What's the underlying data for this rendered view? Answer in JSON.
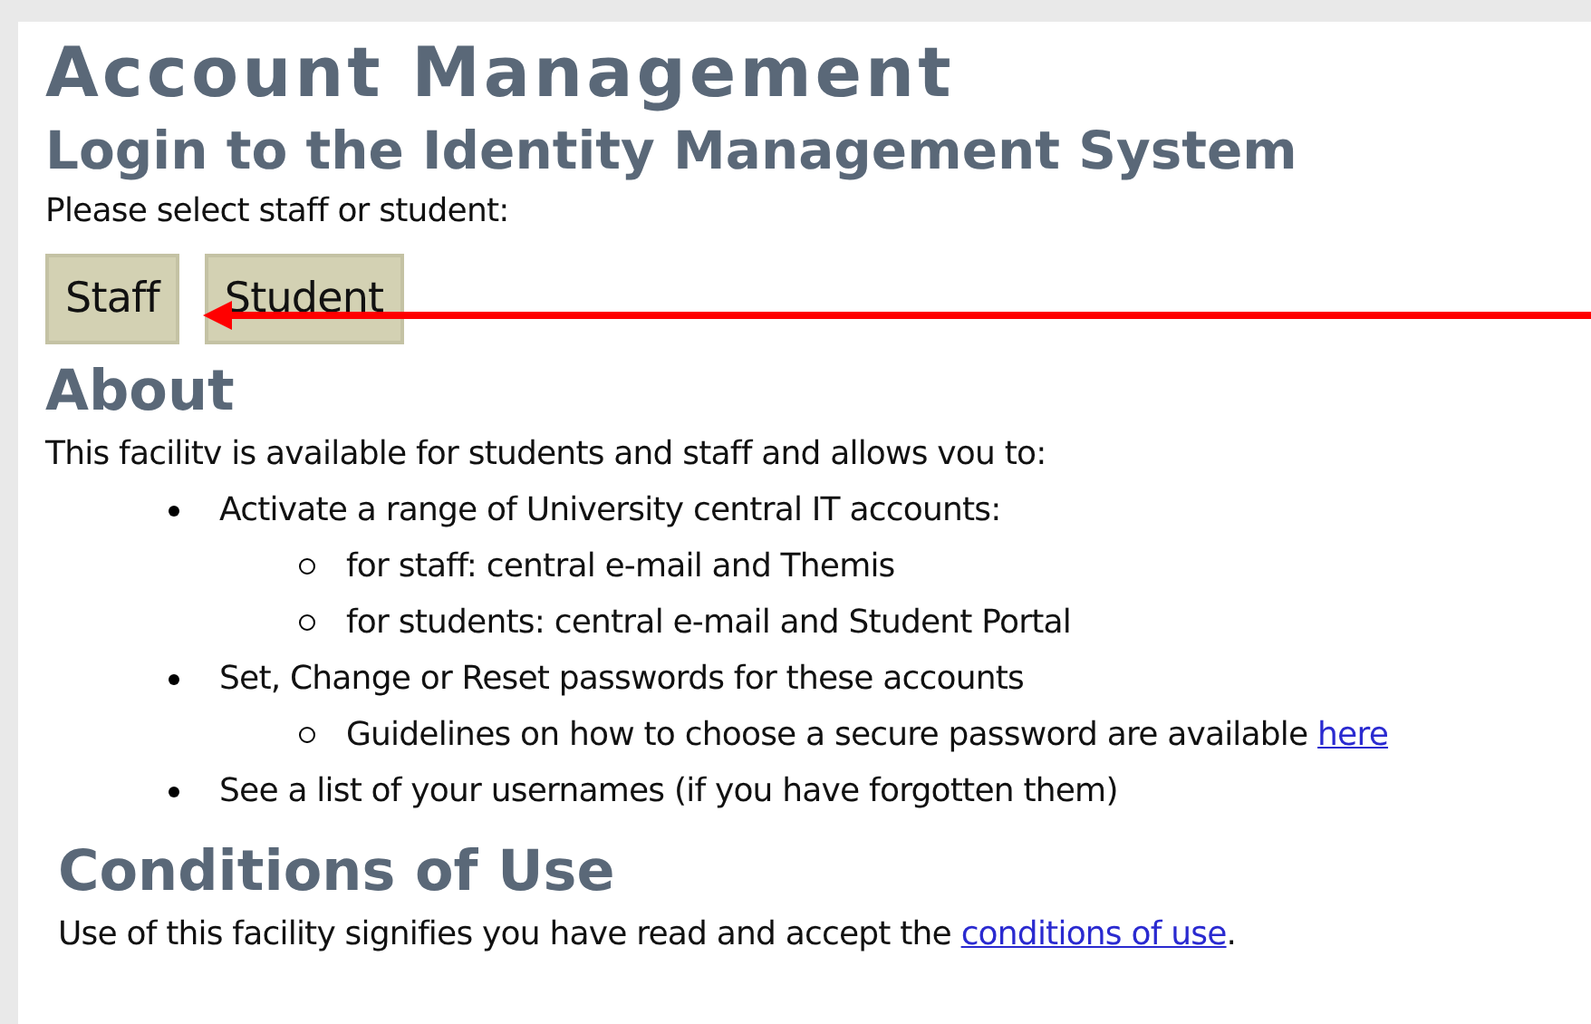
{
  "title": "Account Management",
  "login": {
    "heading": "Login to the Identity Management System",
    "prompt": "Please select staff or student:",
    "buttons": [
      "Staff",
      "Student"
    ]
  },
  "about": {
    "heading": "About",
    "intro": "This facilitv is available for students and staff and allows vou to:",
    "items": [
      {
        "text": "Activate a range of University central IT accounts:",
        "children": [
          {
            "text": "for staff: central e-mail and Themis"
          },
          {
            "text": "for students: central e-mail and Student Portal"
          }
        ]
      },
      {
        "text": "Set, Change or Reset passwords for these accounts",
        "children": [
          {
            "text": "Guidelines on how to choose a secure password are available",
            "link": "here"
          }
        ]
      },
      {
        "text": "See a list of your usernames (if you have forgotten them)"
      }
    ]
  },
  "conditions": {
    "heading": "Conditions of Use",
    "text": "Use of this facility signifies you have read and accept the",
    "link": "conditions of use",
    "suffix": "."
  }
}
